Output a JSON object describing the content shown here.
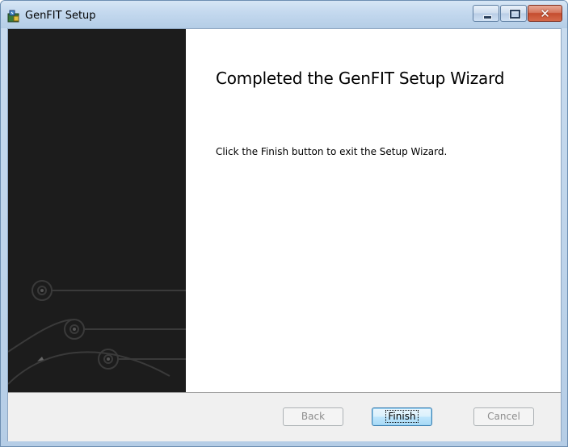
{
  "window": {
    "title": "GenFIT Setup"
  },
  "caption_buttons": {
    "minimize_icon": "minimize-icon",
    "maximize_icon": "maximize-icon",
    "close_icon": "close-icon",
    "close_glyph": "✕"
  },
  "content": {
    "heading": "Completed the GenFIT Setup Wizard",
    "body": "Click the Finish button to exit the Setup Wizard."
  },
  "buttons": {
    "back": {
      "label": "Back",
      "enabled": false
    },
    "finish": {
      "label": "Finish",
      "enabled": true,
      "default": true
    },
    "cancel": {
      "label": "Cancel",
      "enabled": false
    }
  },
  "colors": {
    "banner": "#1c1c1c",
    "titlebar": "#c3d8ee",
    "close_button": "#c54d2f",
    "footer": "#f0f0f0"
  }
}
